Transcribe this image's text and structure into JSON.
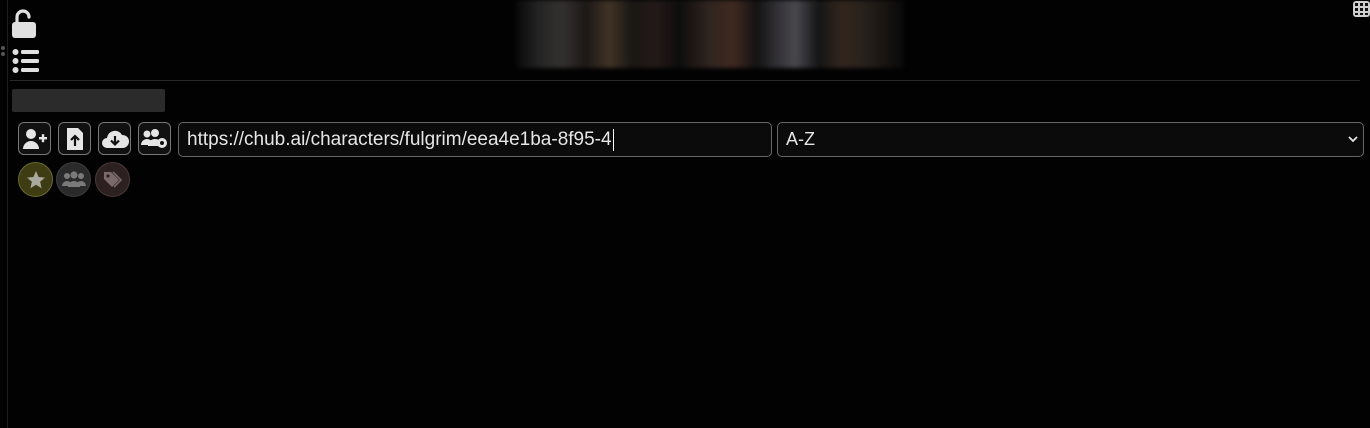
{
  "header": {
    "avatars_region": "avatar-strip"
  },
  "toolbar": {
    "buttons": [
      {
        "name": "create-character-button",
        "icon": "user-plus-icon"
      },
      {
        "name": "import-file-button",
        "icon": "file-upload-icon"
      },
      {
        "name": "import-from-url-button",
        "icon": "cloud-download-icon"
      },
      {
        "name": "create-group-button",
        "icon": "users-gear-icon"
      }
    ],
    "url_input": {
      "value": "https://chub.ai/characters/fulgrim/eea4e1ba-8f95-4"
    },
    "sort_select": {
      "selected": "A-Z"
    }
  },
  "filters": [
    {
      "name": "favorites-filter",
      "icon": "star-icon",
      "color": "#3d3c12"
    },
    {
      "name": "groups-filter",
      "icon": "users-icon",
      "color": "#2a2a2a"
    },
    {
      "name": "tags-filter",
      "icon": "tag-icon",
      "color": "#2c2020"
    }
  ],
  "colors": {
    "background": "#020202",
    "border": "#666666",
    "text": "#e6e6e6"
  }
}
